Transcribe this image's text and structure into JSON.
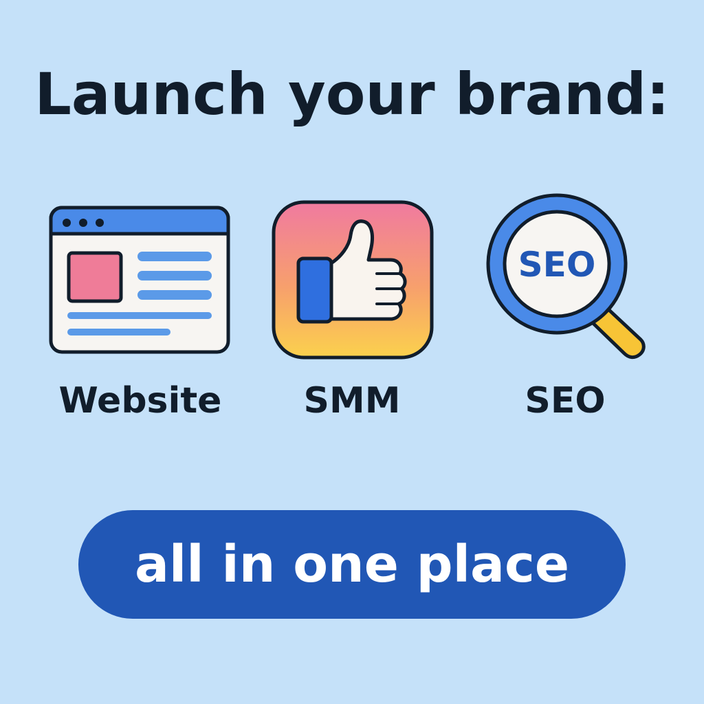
{
  "headline": "Launch your brand:",
  "features": [
    {
      "label": "Website",
      "icon": "browser-window-icon"
    },
    {
      "label": "SMM",
      "icon": "thumbs-up-icon"
    },
    {
      "label": "SEO",
      "icon": "magnifying-glass-seo-icon",
      "icon_text": "SEO"
    }
  ],
  "cta": {
    "label": "all in one place"
  },
  "colors": {
    "background": "#c5e1f9",
    "text": "#111d2b",
    "accent_blue": "#2157b5",
    "icon_blue": "#3f7fe6",
    "icon_pink": "#ef7c98",
    "icon_yellow": "#fbd14d"
  }
}
